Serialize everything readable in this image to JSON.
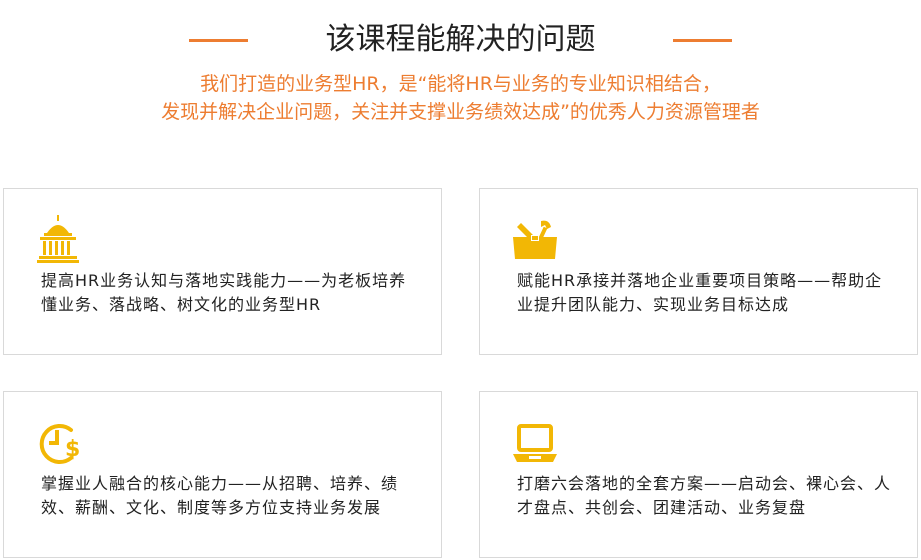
{
  "header": {
    "title": "该课程能解决的问题",
    "subtitle_line1": "我们打造的业务型HR，是“能将HR与业务的专业知识相结合，",
    "subtitle_line2": "发现并解决企业问题，关注并支撑业务绩效达成”的优秀人力资源管理者"
  },
  "cards": [
    {
      "icon": "building-icon",
      "text": "提高HR业务认知与落地实践能力——为老板培养懂业务、落战略、树文化的业务型HR"
    },
    {
      "icon": "toolbox-icon",
      "text": "赋能HR承接并落地企业重要项目策略——帮助企业提升团队能力、实现业务目标达成"
    },
    {
      "icon": "clock-dollar-icon",
      "text": "掌握业人融合的核心能力——从招聘、培养、绩效、薪酬、文化、制度等多方位支持业务发展"
    },
    {
      "icon": "laptop-icon",
      "text": "打磨六会落地的全套方案——启动会、裸心会、人才盘点、共创会、团建活动、业务复盘"
    }
  ],
  "colors": {
    "accent": "#ed7d31",
    "icon": "#f2b705",
    "border": "#d9d9d9",
    "text": "#222222"
  }
}
